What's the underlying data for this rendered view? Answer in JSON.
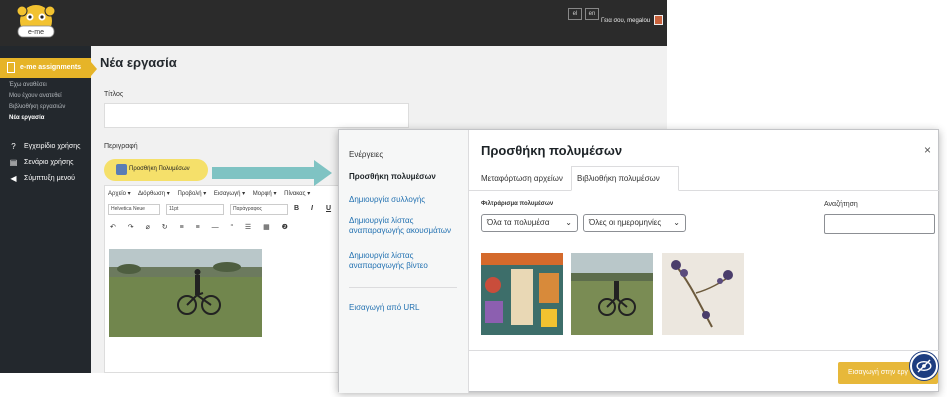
{
  "top_bar": {
    "lang_options": [
      "el",
      "en"
    ],
    "greeting": "Γεια σου, megalou"
  },
  "sidebar": {
    "active_item": "e-me assignments",
    "sub_items": [
      "Έχω αναθέσει",
      "Μου έχουν ανατεθεί",
      "Βιβλιοθήκη εργασιών",
      "Νέα εργασία"
    ],
    "current_sub_item": "Νέα εργασία",
    "main_items": [
      "Εγχειρίδιο χρήσης",
      "Σενάριο χρήσης",
      "Σύμπτυξη μενού"
    ]
  },
  "editor_page": {
    "title": "Νέα εργασία",
    "title_label": "Τίτλος",
    "description_label": "Περιγραφή",
    "add_media_label": "Προσθήκη Πολυμέσων",
    "menubar": [
      "Αρχείο ▾",
      "Διόρθωση ▾",
      "Προβολή ▾",
      "Εισαγωγή ▾",
      "Μορφή ▾",
      "Πίνακας ▾"
    ],
    "font_family": "Helvetica Neue",
    "font_size": "11pt",
    "paragraph_style": "Παράγραφος",
    "bold_label": "B",
    "italic_label": "I",
    "underline_label": "U",
    "toolbar_symbols": "↶ ↷ ⌀ ↻ ≡ ≡ — “ ☰ ▦ ❷"
  },
  "media_modal": {
    "menu_heading": "Ενέργειες",
    "menu_items": [
      "Προσθήκη πολυμέσων",
      "Δημιουργία συλλογής",
      "Δημιουργία λίστας αναπαραγωγής ακουσμάτων",
      "Δημιουργία λίστας αναπαραγωγής βίντεο"
    ],
    "active_menu_item": "Προσθήκη πολυμέσων",
    "url_item": "Εισαγωγή από URL",
    "title": "Προσθήκη πολυμέσων",
    "close_symbol": "×",
    "tabs": [
      "Μεταφόρτωση αρχείων",
      "Βιβλιοθήκη πολυμέσων"
    ],
    "active_tab": "Βιβλιοθήκη πολυμέσων",
    "filter_label": "Φιλτράρισμα πολυμέσων",
    "filter_type": "Όλα τα πολυμέσα",
    "filter_date": "Όλες οι ημερομηνίες",
    "search_label": "Αναζήτηση",
    "search_value": "",
    "insert_label": "Εισαγωγή στην εργ"
  },
  "colors": {
    "accent": "#e6b428",
    "sidebar_bg": "#23282d",
    "topbar_bg": "#2b2b2b",
    "link": "#2271b1",
    "callout_arrow": "#7fc3c3",
    "insert_button": "#e7b83a",
    "badge": "#1d3d80"
  },
  "icons": [
    "e-me-logo",
    "user-avatar",
    "assignment-icon",
    "help-icon",
    "scenario-icon",
    "collapse-icon",
    "media-icon",
    "close-icon",
    "eye-badge-icon"
  ]
}
